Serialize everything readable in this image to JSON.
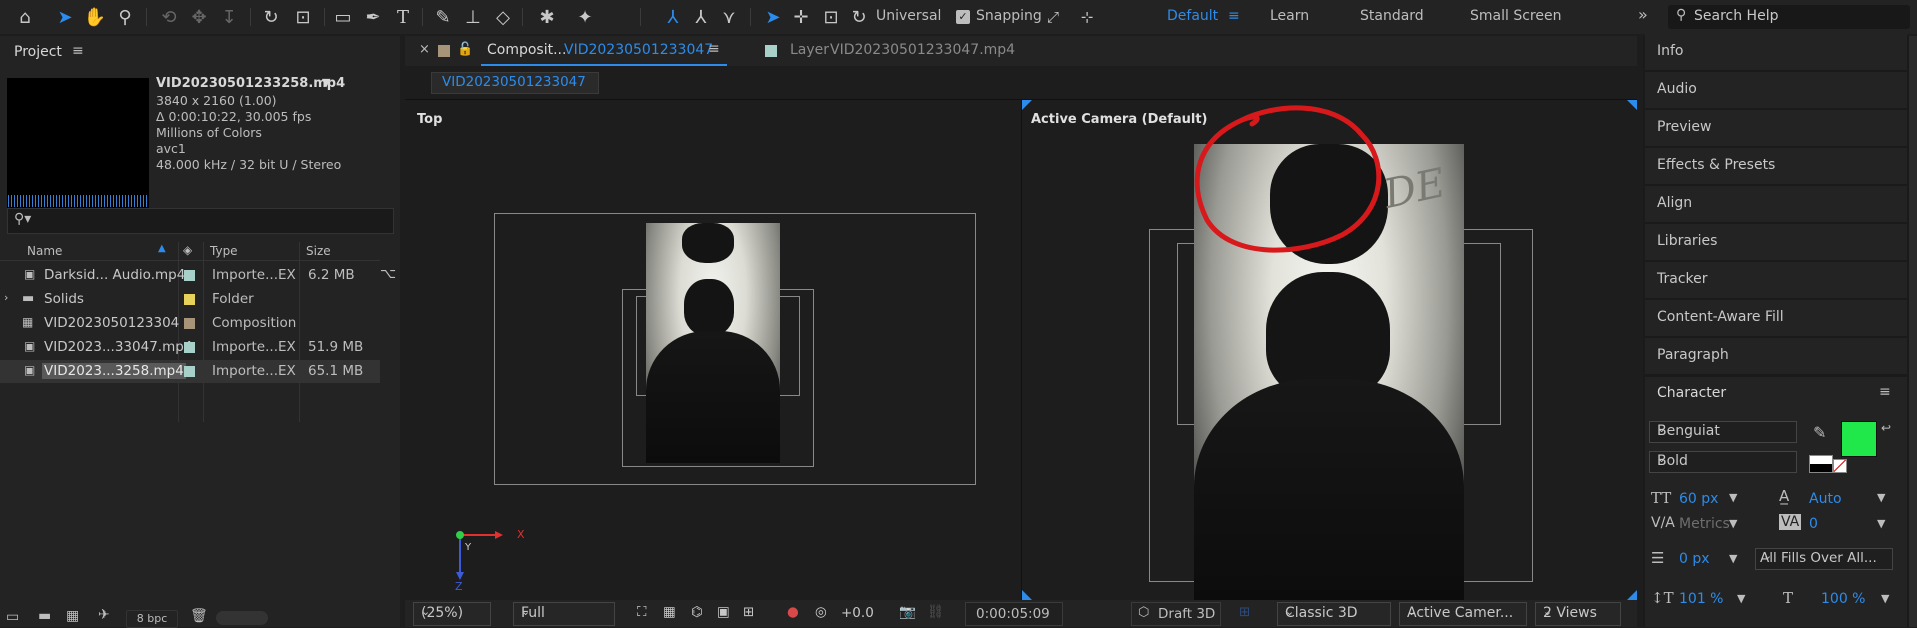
{
  "toolbar": {
    "universal_label": "Universal",
    "snapping_label": "Snapping",
    "workspaces": [
      "Default",
      "Learn",
      "Standard",
      "Small Screen"
    ],
    "active_workspace": "Default",
    "search_placeholder": "Search Help"
  },
  "project": {
    "title": "Project",
    "preview": {
      "filename": "VID20230501233258.mp4",
      "resolution": "3840 x 2160 (1.00)",
      "duration": "Δ 0:00:10:22, 30.005 fps",
      "colors": "Millions of Colors",
      "codec": "avc1",
      "audio": "48.000 kHz / 32 bit U / Stereo"
    },
    "columns": {
      "name": "Name",
      "type": "Type",
      "size": "Size"
    },
    "files": [
      {
        "name": "Darksid... Audio.mp4",
        "type": "Importe...EX",
        "size": "6.2 MB",
        "color": "#a6d0c8"
      },
      {
        "name": "Solids",
        "type": "Folder",
        "size": "",
        "color": "#e6d25a"
      },
      {
        "name": "VID2023050123304",
        "type": "Composition",
        "size": "",
        "color": "#a89478"
      },
      {
        "name": "VID2023...33047.mp4",
        "type": "Importe...EX",
        "size": "51.9 MB",
        "color": "#a6d0c8"
      },
      {
        "name": "VID2023...3258.mp4",
        "type": "Importe...EX",
        "size": "65.1 MB",
        "color": "#a6d0c8"
      }
    ],
    "bpc": "8 bpc"
  },
  "composition": {
    "tab_label": "Composit...",
    "tab_comp_name": "VID20230501233047",
    "layer_label": "Layer",
    "layer_name": "VID20230501233047.mp4",
    "breadcrumb": "VID20230501233047",
    "left_view_label": "Top",
    "right_view_label": "Active Camera (Default)",
    "axis_x": "X",
    "axis_y": "Y",
    "axis_z": "Z",
    "footer": {
      "zoom": "(25%)",
      "resolution": "Full",
      "exposure": "+0.0",
      "timecode": "0:00:05:09",
      "draft3d": "Draft 3D",
      "renderer": "Classic 3D",
      "camera": "Active Camer...",
      "views": "2 Views"
    }
  },
  "right_panel": {
    "items": [
      "Info",
      "Audio",
      "Preview",
      "Effects & Presets",
      "Align",
      "Libraries",
      "Tracker",
      "Content-Aware Fill",
      "Paragraph"
    ],
    "character": {
      "title": "Character",
      "font": "Benguiat",
      "style": "Bold",
      "size": "60 px",
      "leading": "Auto",
      "kerning": "Metrics",
      "tracking": "0",
      "stroke_width": "0 px",
      "stroke_mode": "All Fills Over All...",
      "vscale": "101 %",
      "hscale": "100 %",
      "fill_color": "#21e84a"
    }
  }
}
